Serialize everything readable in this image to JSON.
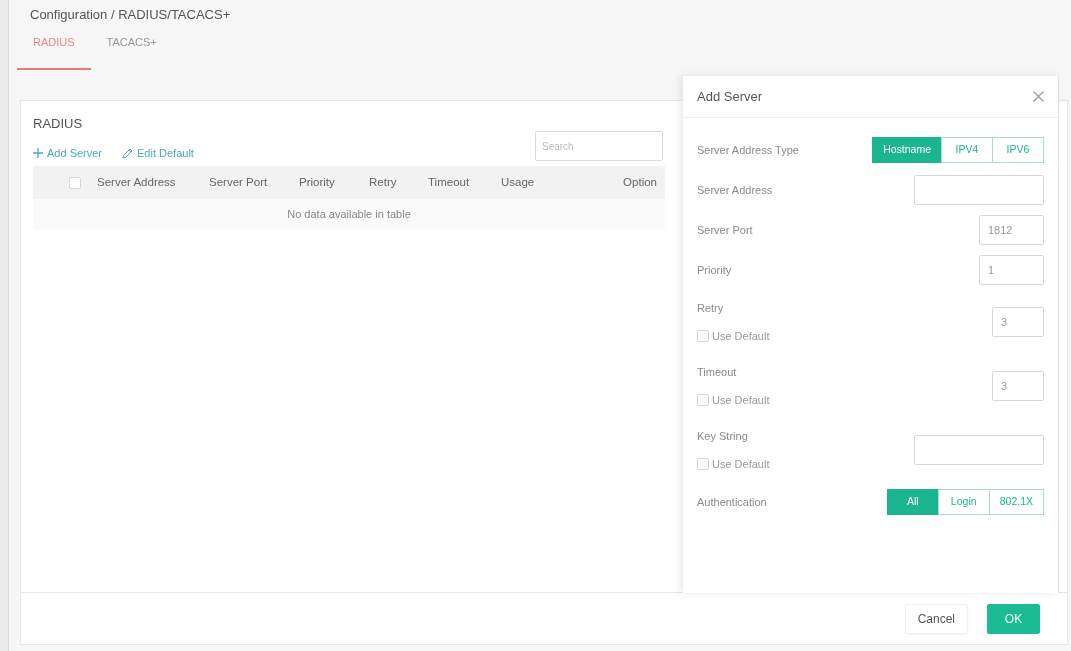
{
  "breadcrumb": "Configuration / RADIUS/TACACS+",
  "tabs": [
    {
      "label": "RADIUS",
      "selected": true
    },
    {
      "label": "TACACS+",
      "selected": false
    }
  ],
  "panel": {
    "title": "RADIUS",
    "actions": [
      {
        "kind": "add",
        "label": "Add Server"
      },
      {
        "kind": "edit",
        "label": "Edit Default"
      }
    ],
    "search": {
      "placeholder": "Search"
    }
  },
  "table": {
    "header_checkbox": {
      "checked": false
    },
    "columns": [
      "Server Address",
      "Server Port",
      "Priority",
      "Retry",
      "Timeout",
      "Usage",
      "Option"
    ],
    "empty_message": "No data available in table"
  },
  "drawer": {
    "title": "Add Server",
    "fields": [
      {
        "kind": "segmented",
        "label": "Server Address Type",
        "options": [
          {
            "label": "Hostname",
            "selected": true
          },
          {
            "label": "IPV4",
            "selected": false
          },
          {
            "label": "IPV6",
            "selected": false
          }
        ]
      },
      {
        "kind": "text",
        "label": "Server Address"
      },
      {
        "kind": "number",
        "label": "Server Port",
        "value": "1812"
      },
      {
        "kind": "number",
        "label": "Priority",
        "value": "1"
      },
      {
        "kind": "number",
        "label": "Retry",
        "value": "3",
        "use_default": {
          "label": "Use Default",
          "checked": false
        }
      },
      {
        "kind": "number",
        "label": "Timeout",
        "value": "3",
        "use_default": {
          "label": "Use Default",
          "checked": false
        }
      },
      {
        "kind": "text",
        "label": "Key String",
        "use_default": {
          "label": "Use Default",
          "checked": false
        }
      },
      {
        "kind": "segmented",
        "label": "Authentication",
        "options": [
          {
            "label": "All",
            "selected": true
          },
          {
            "label": "Login",
            "selected": false
          },
          {
            "label": "802.1X",
            "selected": false
          }
        ]
      }
    ]
  },
  "footer": {
    "buttons": [
      {
        "kind": "secondary",
        "label": "Cancel"
      },
      {
        "kind": "primary",
        "label": "OK"
      }
    ]
  }
}
